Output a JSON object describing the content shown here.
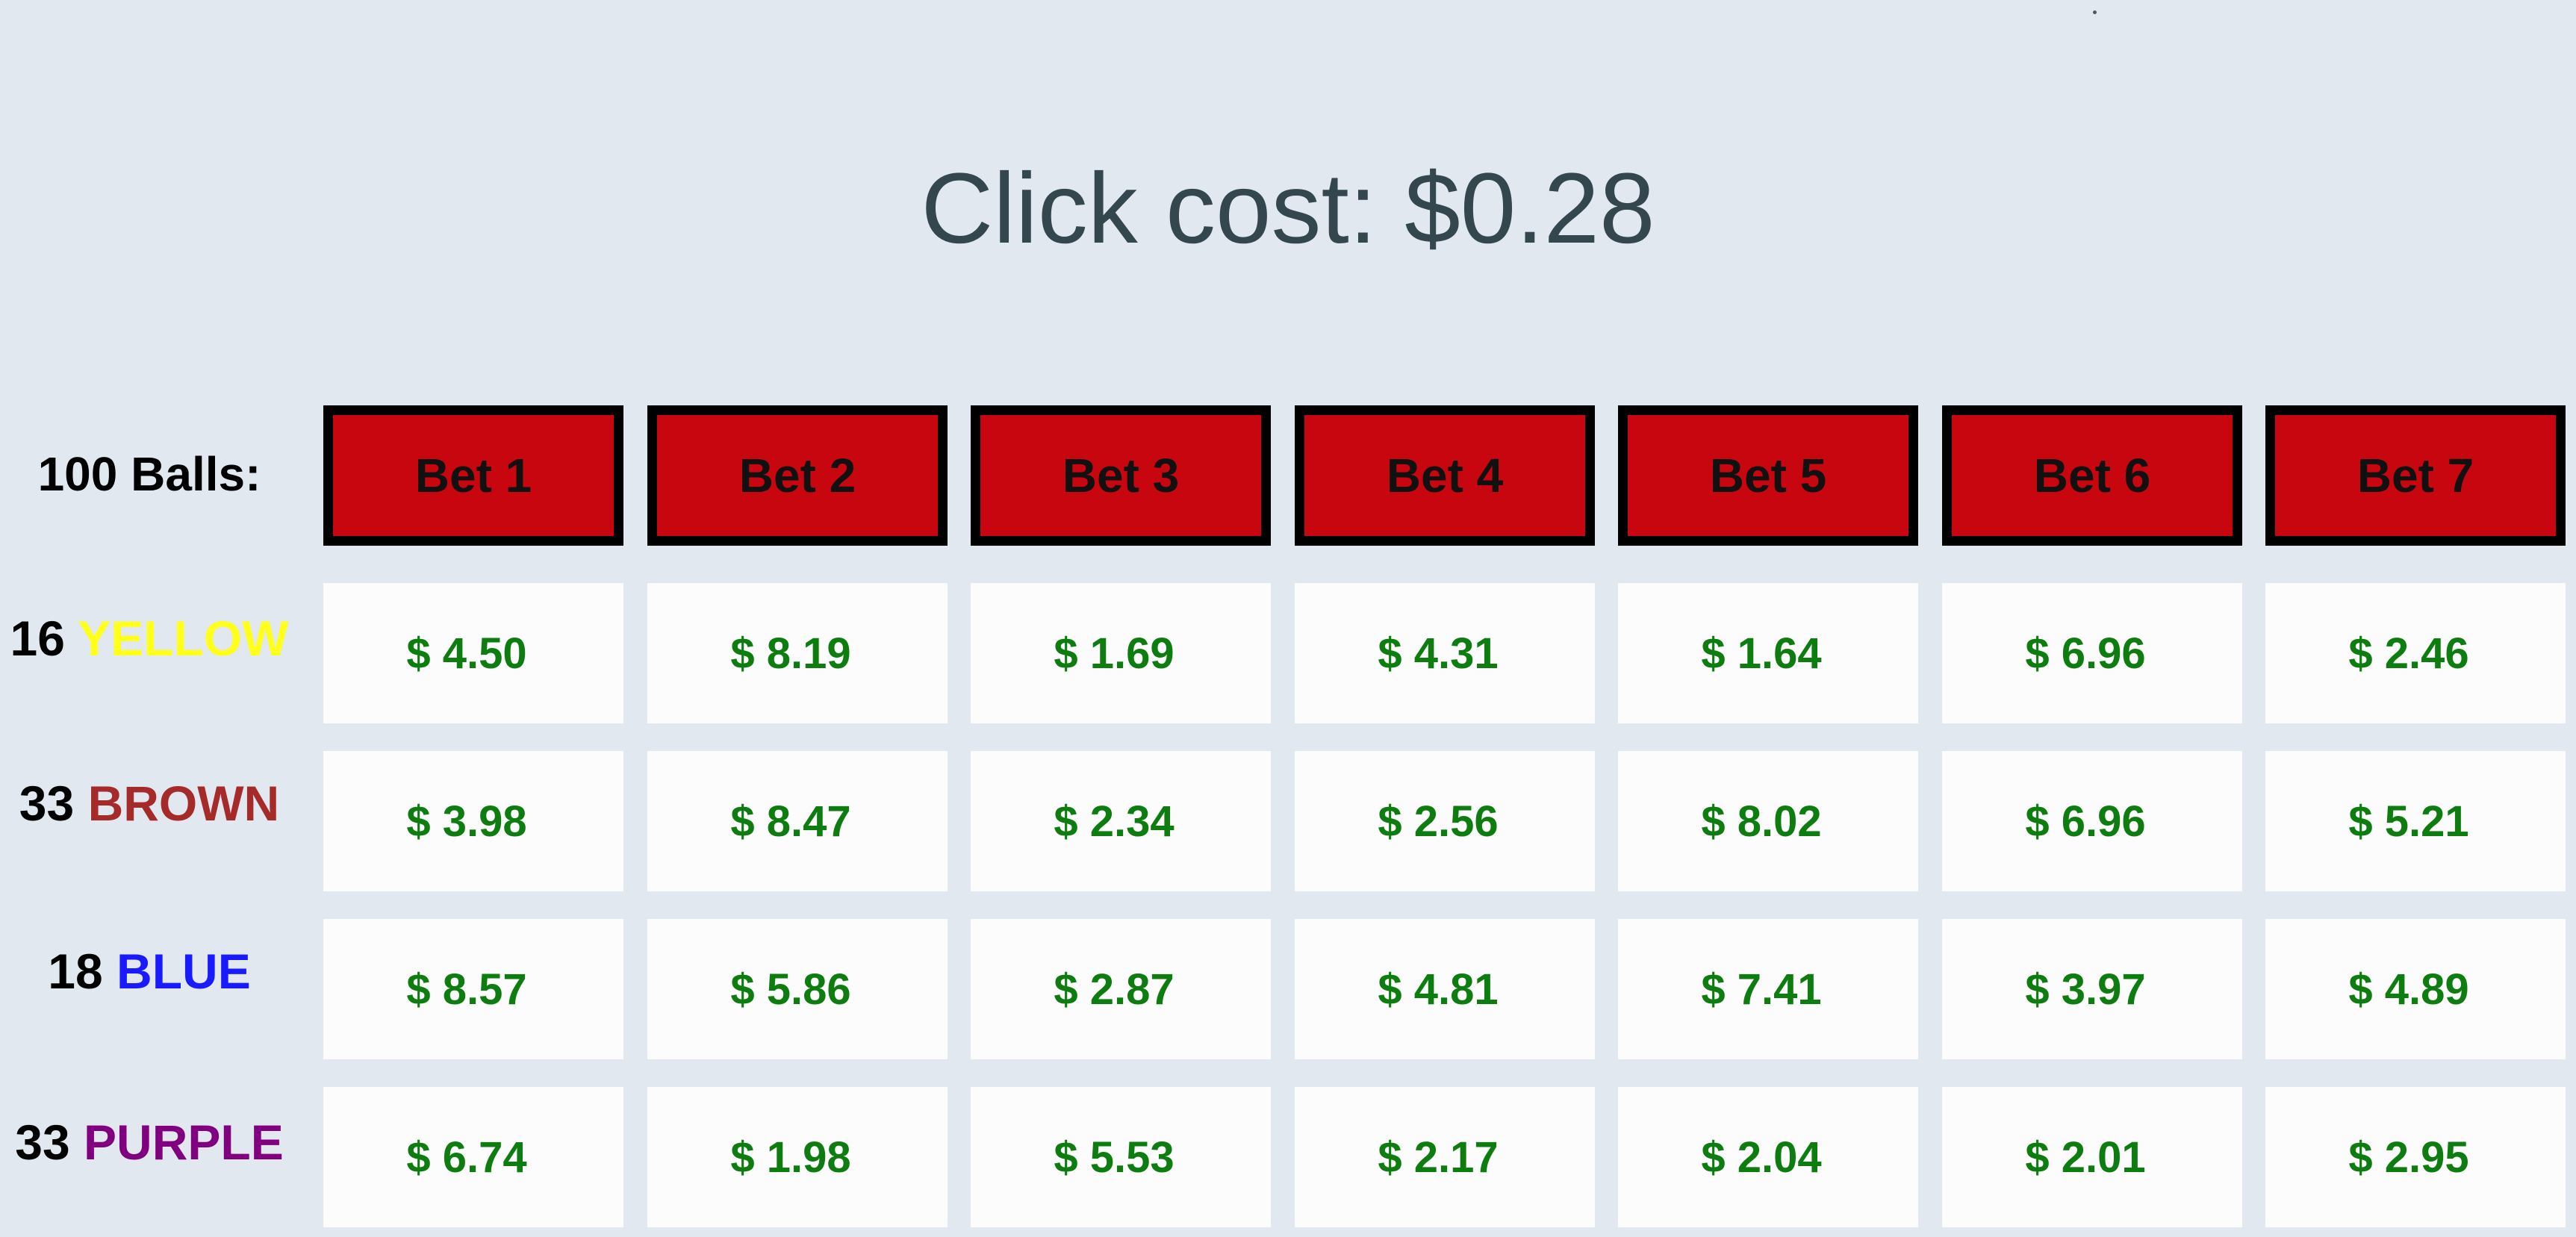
{
  "page": {
    "click_cost": "Click cost: $0.28",
    "balls_label": "100 Balls:"
  },
  "colors": {
    "background": "#e1e8f0",
    "title": "#34474f",
    "bet_button": "#c8060f",
    "cell_background": "#fcfcfc",
    "amount": "#0e7d10",
    "yellow": "#ffff1a",
    "brown": "#a52a2a",
    "blue": "#1a1aff",
    "purple": "#800080"
  },
  "bets": [
    "Bet 1",
    "Bet 2",
    "Bet 3",
    "Bet 4",
    "Bet 5",
    "Bet 6",
    "Bet 7"
  ],
  "rows": [
    {
      "count": "16",
      "color_name": "YELLOW",
      "color": "#ffff1a",
      "values": [
        "$ 4.50",
        "$ 8.19",
        "$ 1.69",
        "$ 4.31",
        "$ 1.64",
        "$ 6.96",
        "$ 2.46"
      ]
    },
    {
      "count": "33",
      "color_name": "BROWN",
      "color": "#a52a2a",
      "values": [
        "$ 3.98",
        "$ 8.47",
        "$ 2.34",
        "$ 2.56",
        "$ 8.02",
        "$ 6.96",
        "$ 5.21"
      ]
    },
    {
      "count": "18",
      "color_name": "BLUE",
      "color": "#1a1aff",
      "values": [
        "$ 8.57",
        "$ 5.86",
        "$ 2.87",
        "$ 4.81",
        "$ 7.41",
        "$ 3.97",
        "$ 4.89"
      ]
    },
    {
      "count": "33",
      "color_name": "PURPLE",
      "color": "#800080",
      "values": [
        "$ 6.74",
        "$ 1.98",
        "$ 5.53",
        "$ 2.17",
        "$ 2.04",
        "$ 2.01",
        "$ 2.95"
      ]
    }
  ]
}
